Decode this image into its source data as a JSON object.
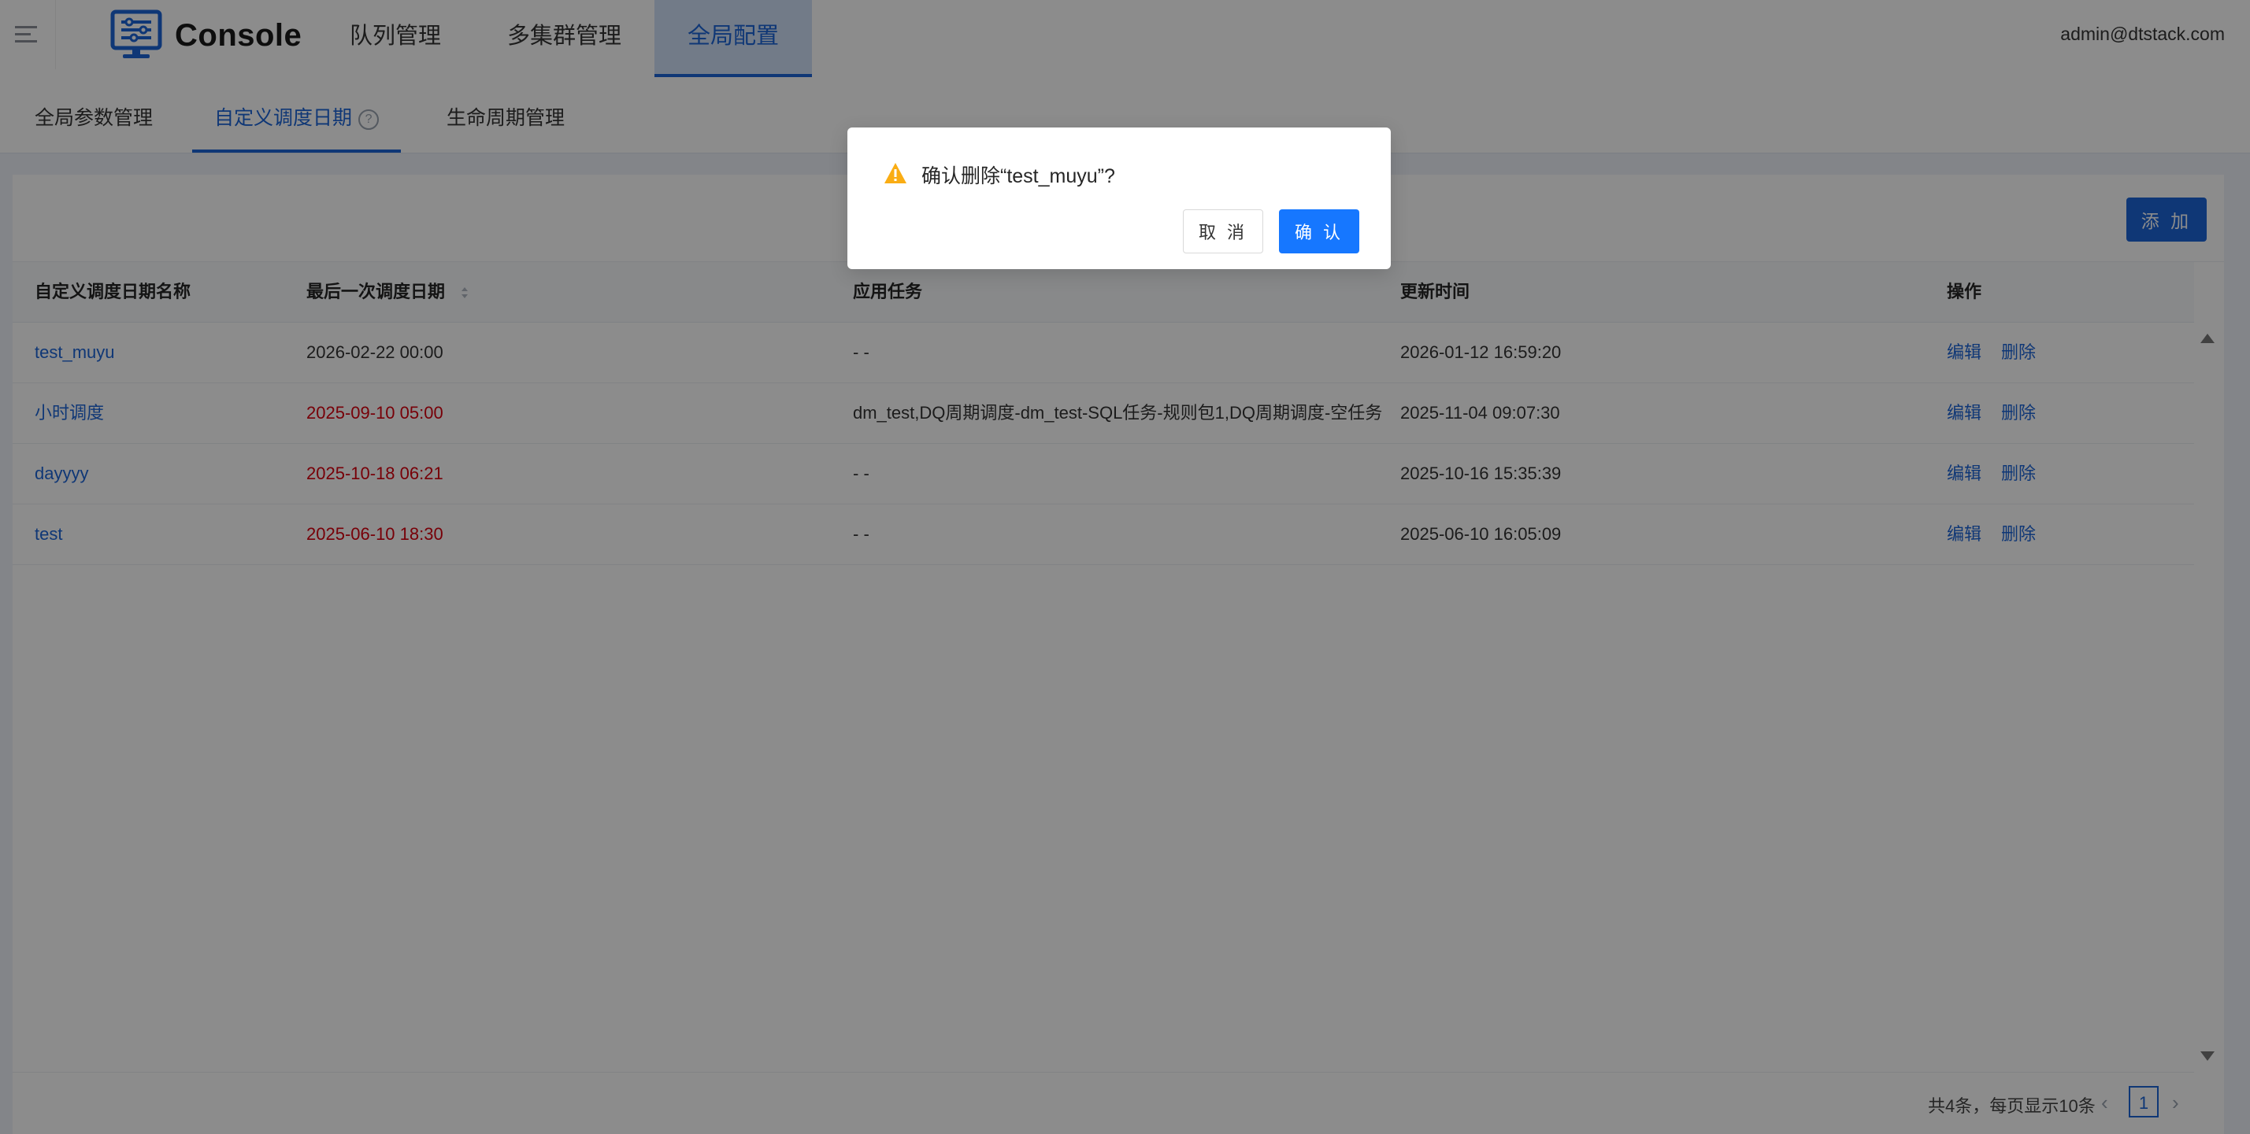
{
  "header": {
    "menu_icon": "hamburger-icon",
    "logo_icon": "console-monitor-icon",
    "app_title": "Console",
    "nav": [
      "队列管理",
      "多集群管理",
      "全局配置"
    ],
    "active_nav": "全局配置",
    "user": "admin@dtstack.com"
  },
  "subtabs": {
    "items": [
      "全局参数管理",
      "自定义调度日期",
      "生命周期管理"
    ],
    "active": "自定义调度日期",
    "help_icon": "question-circle-icon"
  },
  "toolbar": {
    "add_label": "添 加"
  },
  "table": {
    "columns": [
      "自定义调度日期名称",
      "最后一次调度日期",
      "应用任务",
      "更新时间",
      "操作"
    ],
    "sort_icon": "sort-caret-icon",
    "rows": [
      {
        "name": "test_muyu",
        "last_date": "2026-02-22 00:00",
        "last_date_expired": false,
        "tasks": "- -",
        "updated": "2026-01-12 16:59:20",
        "edit": "编辑",
        "delete": "删除"
      },
      {
        "name": "小时调度",
        "last_date": "2025-09-10 05:00",
        "last_date_expired": true,
        "tasks": "dm_test,DQ周期调度-dm_test-SQL任务-规则包1,DQ周期调度-空任务",
        "updated": "2025-11-04 09:07:30",
        "edit": "编辑",
        "delete": "删除"
      },
      {
        "name": "dayyyy",
        "last_date": "2025-10-18 06:21",
        "last_date_expired": true,
        "tasks": "- -",
        "updated": "2025-10-16 15:35:39",
        "edit": "编辑",
        "delete": "删除"
      },
      {
        "name": "test",
        "last_date": "2025-06-10 18:30",
        "last_date_expired": true,
        "tasks": "- -",
        "updated": "2025-06-10 16:05:09",
        "edit": "编辑",
        "delete": "删除"
      }
    ]
  },
  "pagination": {
    "total_text": "共4条，每页显示10条",
    "current_page": "1",
    "prev_icon": "chevron-left-icon",
    "next_icon": "chevron-right-icon"
  },
  "modal": {
    "icon": "warning-triangle-icon",
    "title": "确认删除“test_muyu”?",
    "cancel_label": "取 消",
    "ok_label": "确 认"
  },
  "colors": {
    "primary": "#1d65d8",
    "danger": "#d9000f",
    "warning": "#faad14",
    "overlay": "rgba(0,0,0,0.45)"
  }
}
